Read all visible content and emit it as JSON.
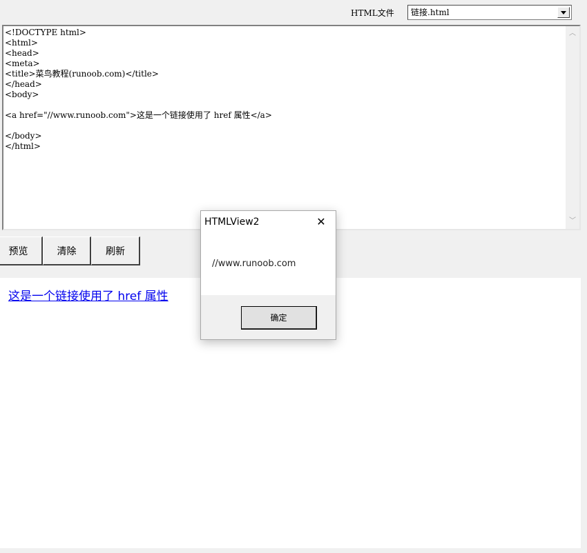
{
  "toolbar": {
    "label": "HTML文件",
    "file_select": {
      "value": "链接.html",
      "icon": "chevron-down-icon"
    }
  },
  "editor": {
    "code": "<!DOCTYPE html>\n<html>\n<head>\n<meta>\n<title>菜鸟教程(runoob.com)</title>\n</head>\n<body>\n\n<a href=\"//www.runoob.com\">这是一个链接使用了 href 属性</a>\n\n</body>\n</html>"
  },
  "buttons": {
    "preview": "预览",
    "clear": "清除",
    "refresh": "刷新"
  },
  "preview": {
    "link_text": "这是一个链接使用了 href 属性"
  },
  "dialog": {
    "title": "HTMLView2",
    "message": "//www.runoob.com",
    "ok": "确定",
    "close_glyph": "✕"
  }
}
